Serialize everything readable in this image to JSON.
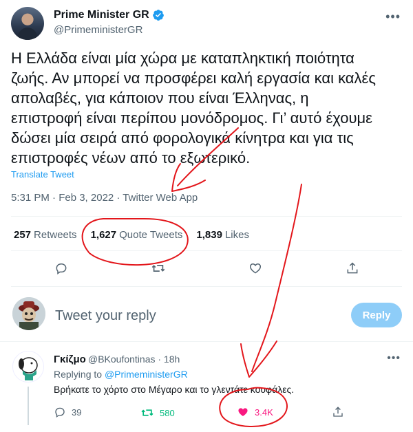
{
  "tweet": {
    "author_name": "Prime Minister GR",
    "author_handle": "@PrimeministerGR",
    "text": "Η Ελλάδα είναι μία χώρα με καταπληκτική ποιότητα\nζωής. Αν μπορεί να προσφέρει καλή εργασία και καλές\nαπολαβές, για κάποιον που είναι Έλληνας, η\nεπιστροφή είναι περίπου μονόδρομος. Γι’ αυτό έχουμε\nδώσει μία σειρά από φορολογικά κίνητρα και για τις\nεπιστροφές νέων από το εξωτερικό.",
    "translate_label": "Translate Tweet",
    "meta": "5:31 PM · Feb 3, 2022 · Twitter Web App",
    "stats": {
      "retweets_count": "257",
      "retweets_label": "Retweets",
      "quotes_count": "1,627",
      "quotes_label": "Quote Tweets",
      "likes_count": "1,839",
      "likes_label": "Likes"
    }
  },
  "reply_box": {
    "placeholder": "Tweet your reply",
    "button_label": "Reply"
  },
  "reply": {
    "author_name": "Γκίζμο",
    "author_handle_time": "@BKoufontinas · 18h",
    "replying_prefix": "Replying to",
    "replying_to": "@PrimeministerGR",
    "text": "Βρήκατε το χόρτο στο Μέγαρο και το γλεντάτε κουφάλες.",
    "replies": "39",
    "retweets": "580",
    "likes": "3.4K"
  },
  "colors": {
    "accent": "#1d9bf0",
    "retweet": "#00ba7c",
    "like": "#f91880",
    "annotation": "#e3161b"
  }
}
